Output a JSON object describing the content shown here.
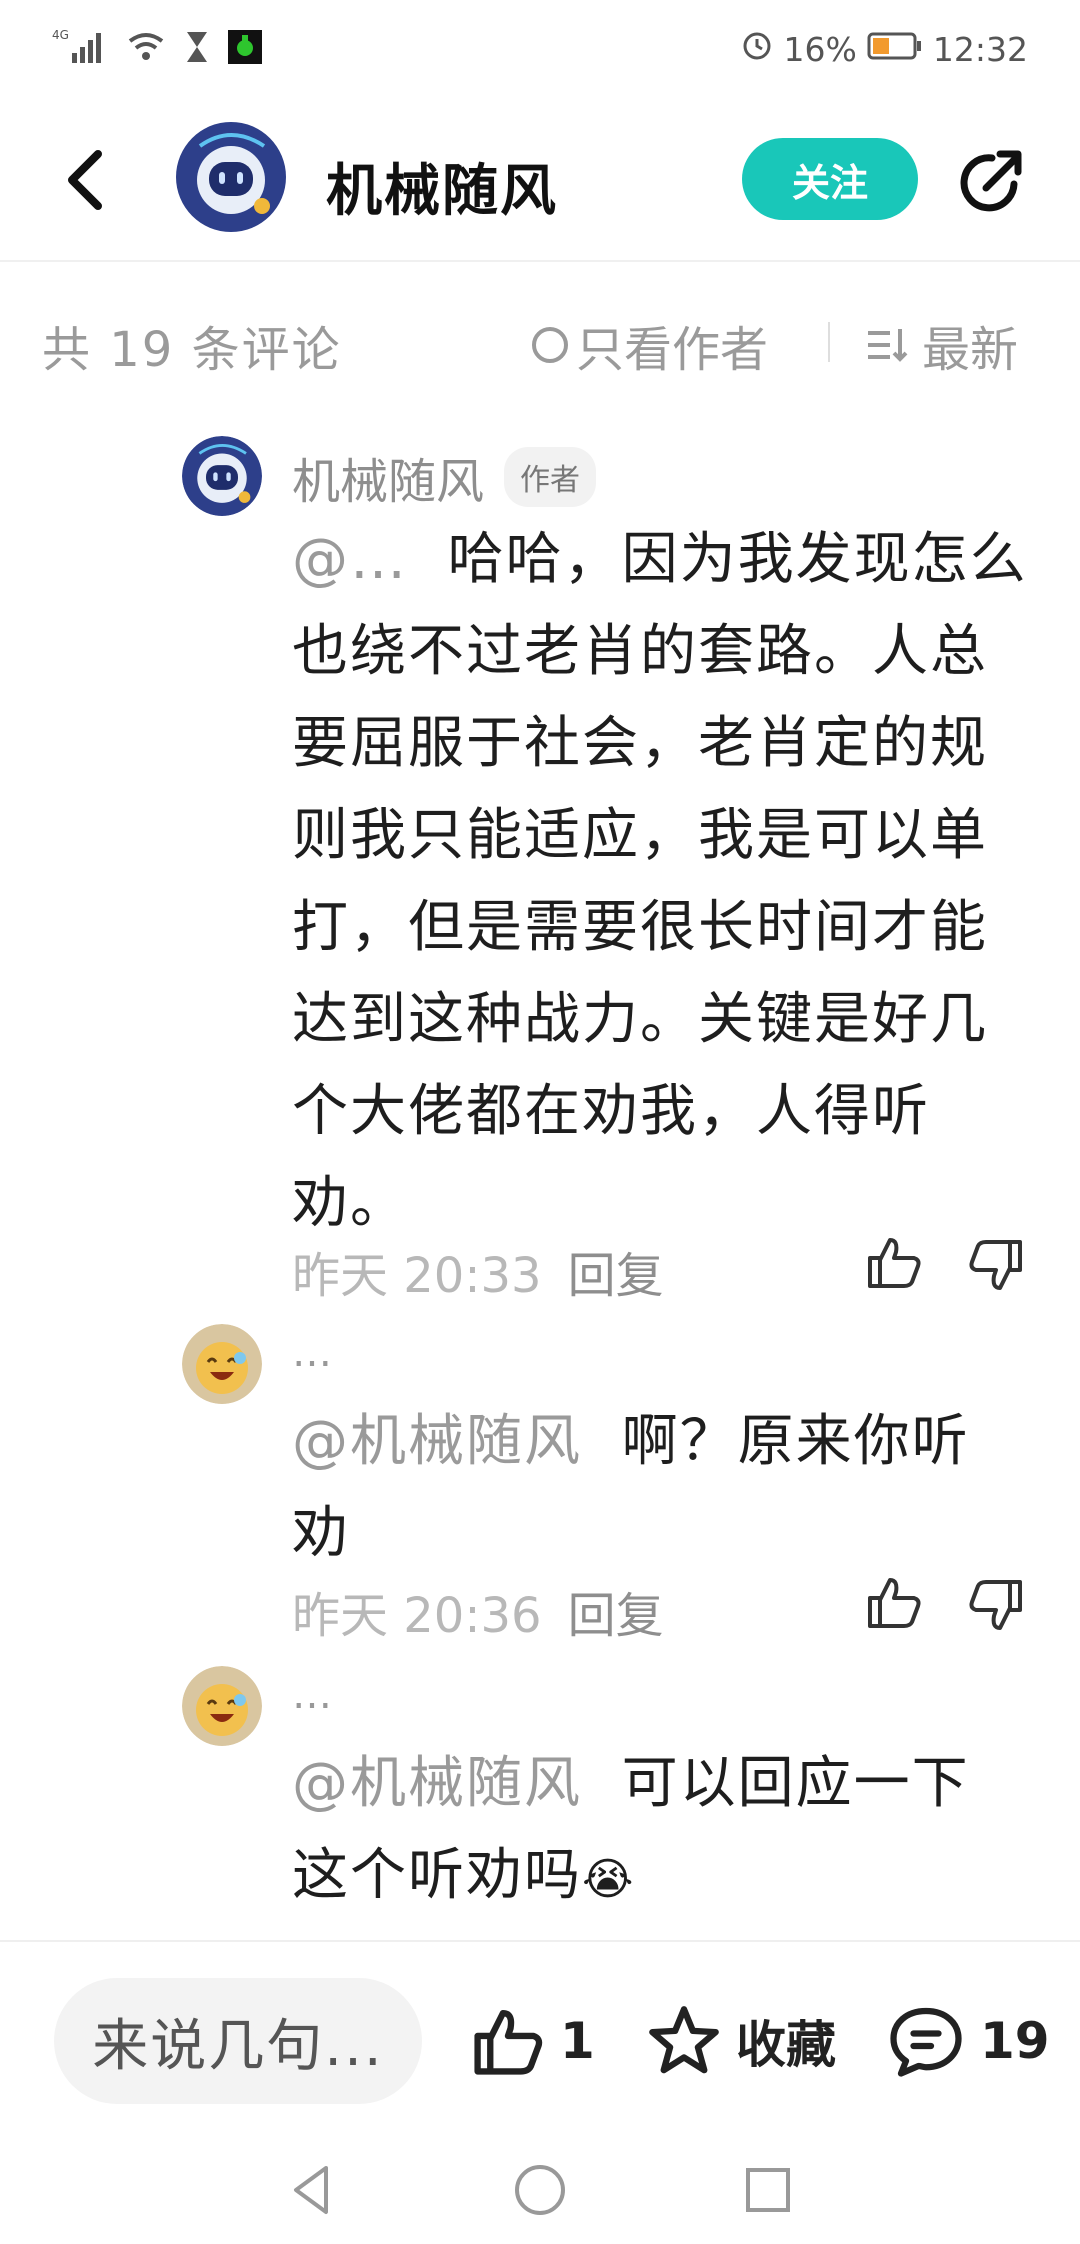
{
  "status_bar": {
    "network": "4G",
    "battery": "16%",
    "time": "12:32"
  },
  "header": {
    "username": "机械随风",
    "follow_label": "关注"
  },
  "filter": {
    "count_label": "共 19 条评论",
    "author_only_label": "只看作者",
    "sort_label": "最新"
  },
  "comments": [
    {
      "name": "机械随风",
      "badge": "作者",
      "mention": "@…",
      "text_line1": "哈哈，因为我发现怎么",
      "text_rest": [
        "也绕不过老肖的套路。人总",
        "要屈服于社会，老肖定的规",
        "则我只能适应，我是可以单",
        "打，但是需要很长时间才能",
        "达到这种战力。关键是好几",
        "个大佬都在劝我，人得听",
        "劝。"
      ],
      "time": "昨天 20:33",
      "reply_label": "回复"
    },
    {
      "name": "…",
      "mention": "@机械随风",
      "text_line1": "啊？原来你听",
      "text_rest": [
        "劝"
      ],
      "time": "昨天 20:36",
      "reply_label": "回复"
    },
    {
      "name": "…",
      "mention": "@机械随风",
      "text_line1": "可以回应一下",
      "text_rest": [
        "这个听劝吗"
      ],
      "emoji": "😭"
    }
  ],
  "bottom_bar": {
    "input_placeholder": "来说几句...",
    "like_count": "1",
    "collect_label": "收藏",
    "comment_count": "19"
  },
  "colors": {
    "accent": "#19c7b9",
    "muted_text": "#9a9a9a",
    "body_text": "#1e1e1e"
  }
}
